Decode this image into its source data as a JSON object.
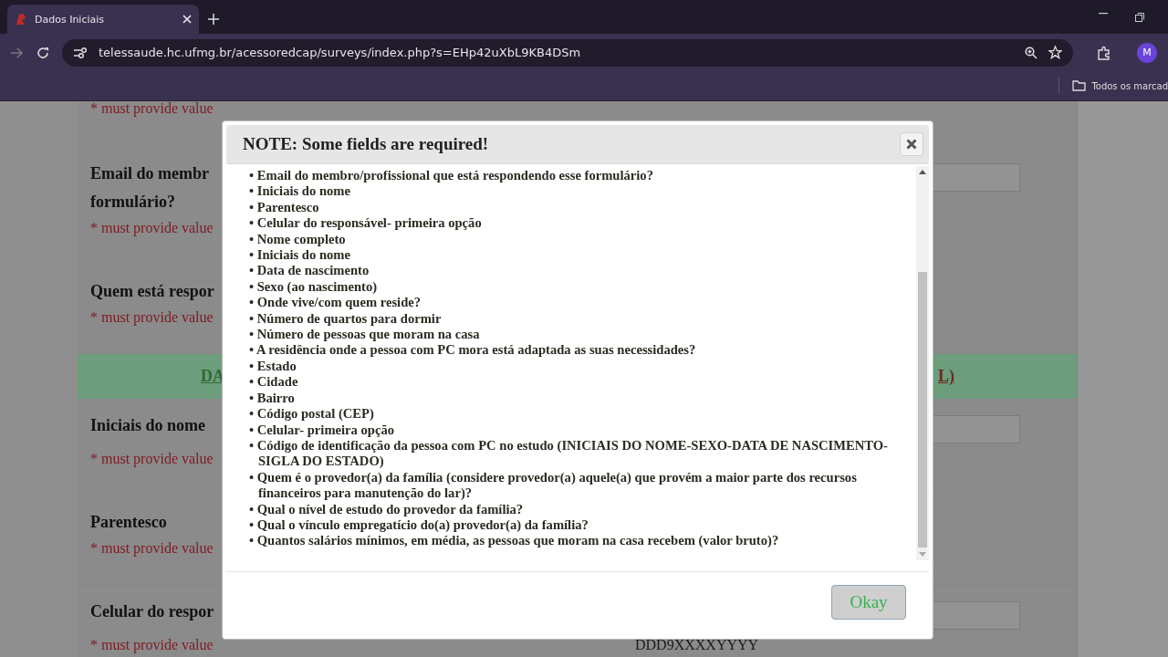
{
  "browser": {
    "tab_title": "Dados Iniciais",
    "url": "telessaude.hc.ufmg.br/acessoredcap/surveys/index.php?s=EHp42uXbL9KB4DSm",
    "profile": "M",
    "bookmark": "Todos os marcad"
  },
  "form": {
    "rows": [
      {
        "kind": "question",
        "label": [],
        "note": "* must provide value",
        "field": false
      },
      {
        "kind": "question",
        "label": [
          "Email do membr",
          "formulário?"
        ],
        "note": "* must provide value",
        "field": true
      },
      {
        "kind": "question",
        "label": [
          "Quem está respor"
        ],
        "note": "* must provide value",
        "field": false
      },
      {
        "kind": "section",
        "left": "DA",
        "right": "L)"
      },
      {
        "kind": "question",
        "label": [
          "Iniciais do nome"
        ],
        "note": "* must provide value",
        "field": true
      },
      {
        "kind": "question",
        "label": [
          "Parentesco"
        ],
        "note": "* must provide value",
        "field": false
      },
      {
        "kind": "question",
        "label": [
          "Celular do respor"
        ],
        "note": "* must provide value",
        "field": true,
        "hint": "DDD9XXXXYYYY"
      }
    ]
  },
  "dialog": {
    "title": "NOTE: Some fields are required!",
    "items": [
      "• Email do membro/profissional que está respondendo esse formulário?",
      "• Iniciais do nome",
      "• Parentesco",
      "• Celular do responsável- primeira opção",
      "• Nome completo",
      "• Iniciais do nome",
      "• Data de nascimento",
      "• Sexo (ao nascimento)",
      "• Onde vive/com quem reside?",
      "• Número de quartos para dormir",
      "• Número de pessoas que moram na casa",
      "• A residência onde a pessoa com PC mora está adaptada as suas necessidades?",
      "• Estado",
      "• Cidade",
      "• Bairro",
      "• Código postal (CEP)",
      "• Celular- primeira opção",
      "• Código de identificação da pessoa com PC no estudo (INICIAIS DO NOME-SEXO-DATA DE NASCIMENTO-SIGLA DO ESTADO)",
      "• Quem é o provedor(a) da família (considere provedor(a) aquele(a) que provém a maior parte dos recursos financeiros para manutenção do lar)?",
      "• Qual o nível de estudo do provedor da família?",
      "• Qual o vínculo empregatício do(a) provedor(a) da família?",
      "• Quantos salários mínimos, em média, as pessoas que moram na casa recebem (valor bruto)?"
    ],
    "button": "Okay"
  }
}
